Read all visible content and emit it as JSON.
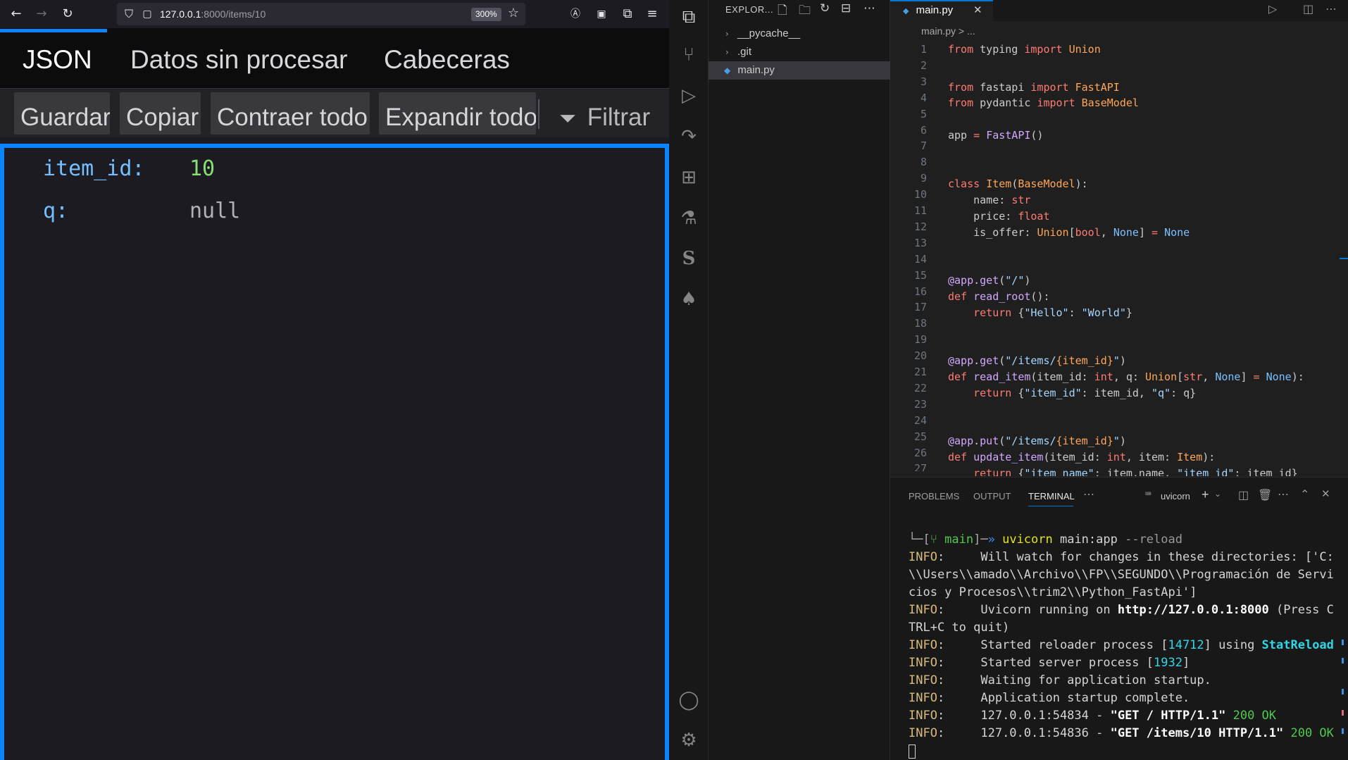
{
  "browser": {
    "url_host": "127.0.0.1",
    "url_path": ":8000/items/10",
    "zoom": "300%",
    "tabs": [
      "JSON",
      "Datos sin procesar",
      "Cabeceras"
    ],
    "toolbar": [
      "Guardar",
      "Copiar",
      "Contraer todo",
      "Expandir todo",
      "Filtrar"
    ],
    "json": {
      "rows": [
        {
          "key": "item_id:",
          "value": "10"
        },
        {
          "key": "q:",
          "value": "null"
        }
      ]
    }
  },
  "explorer": {
    "title": "EXPLOR...",
    "items": [
      "__pycache__",
      ".git",
      "main.py"
    ]
  },
  "editor": {
    "tab": "main.py",
    "breadcrumb": "main.py > ...",
    "line_numbers": [
      "1",
      "2",
      "3",
      "4",
      "5",
      "6",
      "7",
      "8",
      "9",
      "10",
      "11",
      "12",
      "13",
      "14",
      "15",
      "16",
      "17",
      "18",
      "19",
      "20",
      "21",
      "22",
      "23",
      "24",
      "25",
      "26",
      "27"
    ]
  },
  "panel": {
    "tabs": [
      "PROBLEMS",
      "OUTPUT",
      "TERMINAL"
    ],
    "terminal_name": "uvicorn"
  },
  "colors": {
    "accent": "#0a84ff",
    "vscode_accent": "#0078d4"
  }
}
